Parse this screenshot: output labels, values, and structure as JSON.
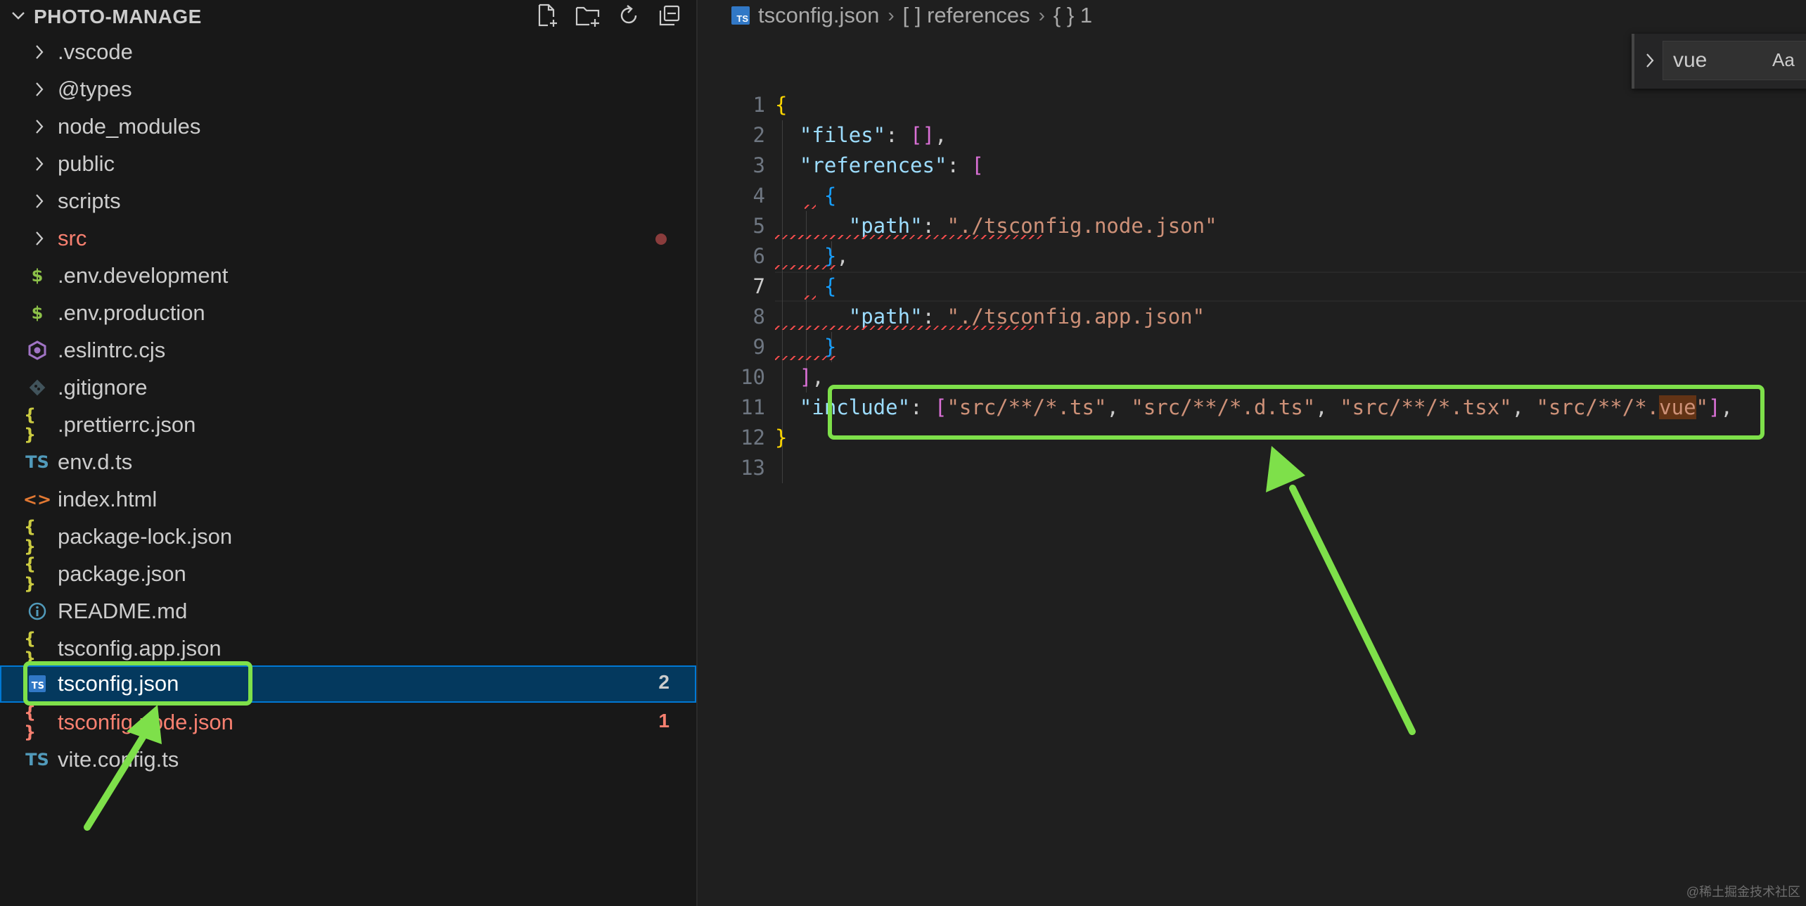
{
  "explorer": {
    "title": "PHOTO-MANAGE",
    "actions": [
      "new-file-icon",
      "new-folder-icon",
      "refresh-icon",
      "collapse-all-icon"
    ],
    "items": [
      {
        "label": ".vscode",
        "type": "folder"
      },
      {
        "label": "@types",
        "type": "folder"
      },
      {
        "label": "node_modules",
        "type": "folder"
      },
      {
        "label": "public",
        "type": "folder"
      },
      {
        "label": "scripts",
        "type": "folder"
      },
      {
        "label": "src",
        "type": "folder",
        "status": "modified-dot"
      },
      {
        "label": ".env.development",
        "type": "file",
        "icon": "dollar-icon"
      },
      {
        "label": ".env.production",
        "type": "file",
        "icon": "dollar-icon"
      },
      {
        "label": ".eslintrc.cjs",
        "type": "file",
        "icon": "eslint-icon"
      },
      {
        "label": ".gitignore",
        "type": "file",
        "icon": "git-icon"
      },
      {
        "label": ".prettierrc.json",
        "type": "file",
        "icon": "json-icon"
      },
      {
        "label": "env.d.ts",
        "type": "file",
        "icon": "ts-icon"
      },
      {
        "label": "index.html",
        "type": "file",
        "icon": "html-icon"
      },
      {
        "label": "package-lock.json",
        "type": "file",
        "icon": "json-icon"
      },
      {
        "label": "package.json",
        "type": "file",
        "icon": "json-icon"
      },
      {
        "label": "README.md",
        "type": "file",
        "icon": "info-icon"
      },
      {
        "label": "tsconfig.app.json",
        "type": "file",
        "icon": "json-icon"
      },
      {
        "label": "tsconfig.json",
        "type": "file",
        "icon": "tsconfig-icon",
        "badge": "2",
        "selected": true
      },
      {
        "label": "tsconfig.node.json",
        "type": "file",
        "icon": "json-icon",
        "badge": "1",
        "error": true
      },
      {
        "label": "vite.config.ts",
        "type": "file",
        "icon": "ts-icon"
      }
    ]
  },
  "breadcrumb": {
    "file": "tsconfig.json",
    "segment2": "[ ] references",
    "segment3": "{ } 1"
  },
  "find": {
    "value": "vue",
    "match_case_label": "Aa"
  },
  "editor": {
    "active_line": 7,
    "line_numbers": [
      "1",
      "2",
      "3",
      "4",
      "5",
      "6",
      "7",
      "8",
      "9",
      "10",
      "11",
      "12",
      "13"
    ],
    "lines": [
      "{",
      "  \"files\": [],",
      "  \"references\": [",
      "    {",
      "      \"path\": \"./tsconfig.node.json\"",
      "    },",
      "    {",
      "      \"path\": \"./tsconfig.app.json\"",
      "    }",
      "  ],",
      "  \"include\": [\"src/**/*.ts\", \"src/**/*.d.ts\", \"src/**/*.tsx\", \"src/**/*.vue\"],",
      "}",
      ""
    ]
  },
  "colors": {
    "highlight_box": "#7ee04a",
    "selection": "#04395e",
    "error": "#f14c4c"
  },
  "watermark": "@稀土掘金技术社区"
}
